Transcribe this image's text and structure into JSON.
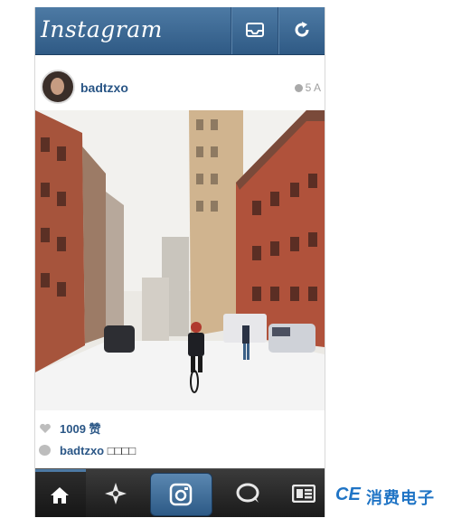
{
  "app": {
    "title": "Instagram"
  },
  "header": {
    "inbox_icon": "inbox-icon",
    "refresh_icon": "refresh-icon"
  },
  "post": {
    "username": "badtzxo",
    "time_ago": "5 A",
    "likes_text": "1009 赞",
    "caption_user": "badtzxo",
    "caption_text": "□□□□"
  },
  "tabbar": {
    "tabs": [
      {
        "name": "home",
        "icon": "home-icon",
        "active": true
      },
      {
        "name": "explore",
        "icon": "explore-icon",
        "active": false
      },
      {
        "name": "camera",
        "icon": "camera-icon",
        "active": false
      },
      {
        "name": "news",
        "icon": "speech-bubble-icon",
        "active": false
      },
      {
        "name": "profile",
        "icon": "profile-card-icon",
        "active": false
      }
    ]
  },
  "brand": {
    "ce": "CE",
    "name": "消费电子"
  },
  "colors": {
    "accent": "#3a6590",
    "brand": "#1f74c5",
    "tabbar": "#222222"
  }
}
